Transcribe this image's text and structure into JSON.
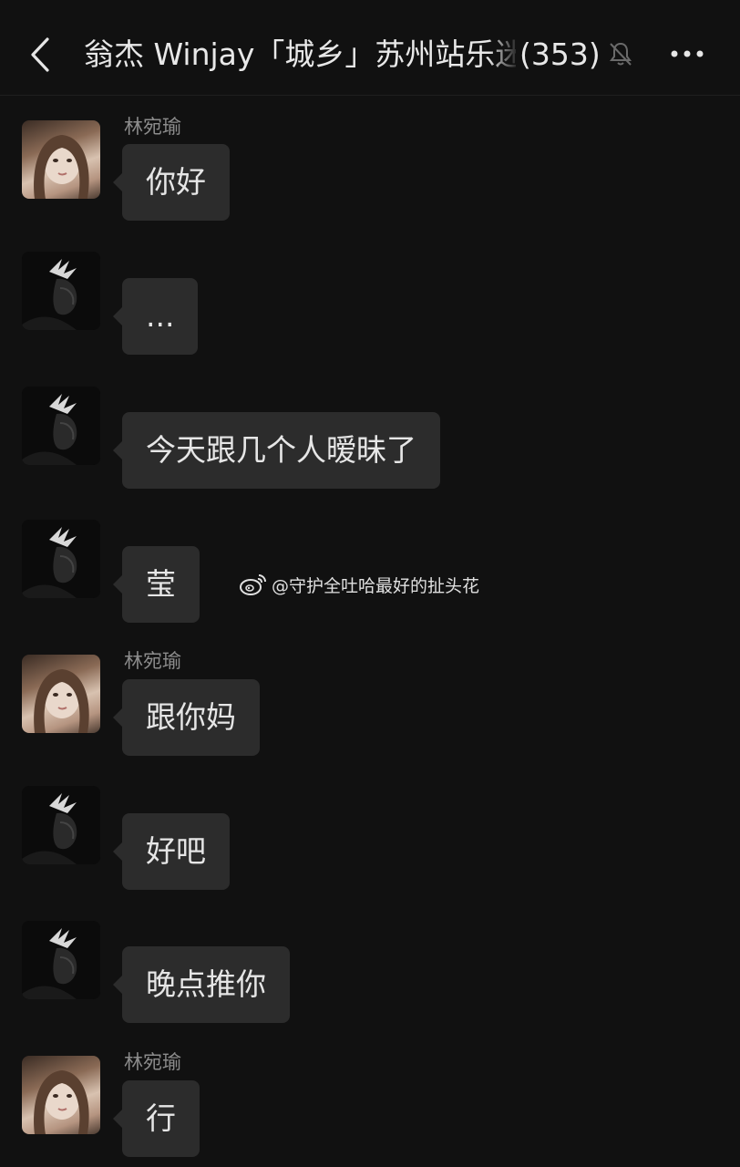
{
  "header": {
    "title": "翁杰 Winjay「城乡」苏州站乐迷",
    "member_count": "(353)",
    "back_icon": "chevron-left-icon",
    "mute_icon": "bell-muted-icon",
    "more_icon": "more-horizontal-icon"
  },
  "watermark": {
    "text": "@守护全吐哈最好的扯头花",
    "icon": "weibo-icon"
  },
  "messages": [
    {
      "sender": "林宛瑜",
      "text": "你好",
      "avatar": "girl-avatar"
    },
    {
      "sender": "",
      "text": "...",
      "avatar": "guy-avatar"
    },
    {
      "sender": "",
      "text": "今天跟几个人暧昧了",
      "avatar": "guy-avatar"
    },
    {
      "sender": "",
      "text": "莹",
      "avatar": "guy-avatar"
    },
    {
      "sender": "林宛瑜",
      "text": "跟你妈",
      "avatar": "girl-avatar"
    },
    {
      "sender": "",
      "text": "好吧",
      "avatar": "guy-avatar"
    },
    {
      "sender": "",
      "text": "晚点推你",
      "avatar": "guy-avatar"
    },
    {
      "sender": "林宛瑜",
      "text": "行",
      "avatar": "girl-avatar"
    }
  ],
  "colors": {
    "background": "#111111",
    "bubble": "#2c2c2c",
    "text": "#e6e6e6",
    "sender": "#8c8c8c"
  }
}
